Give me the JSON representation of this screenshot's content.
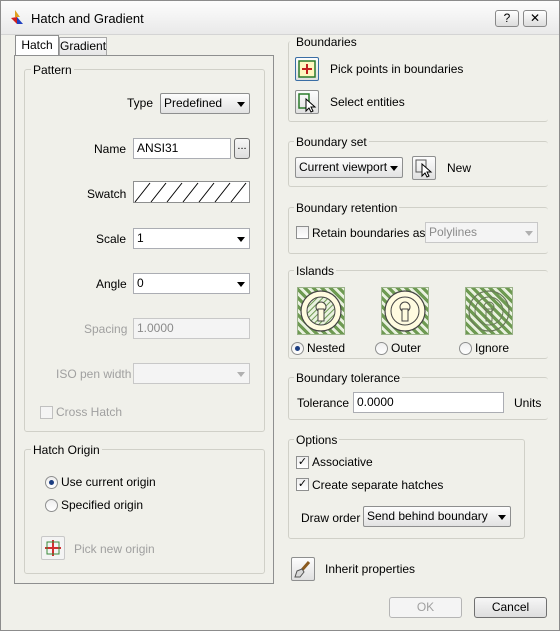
{
  "window": {
    "title": "Hatch and Gradient",
    "help_label": "?",
    "close_label": "✕"
  },
  "tabs": [
    {
      "label": "Hatch"
    },
    {
      "label": "Gradient"
    }
  ],
  "pattern": {
    "title": "Pattern",
    "type_label": "Type",
    "type_value": "Predefined",
    "name_label": "Name",
    "name_value": "ANSI31",
    "browse_label": "...",
    "swatch_label": "Swatch",
    "scale_label": "Scale",
    "scale_value": "1",
    "angle_label": "Angle",
    "angle_value": "0",
    "spacing_label": "Spacing",
    "spacing_value": "1.0000",
    "iso_label": "ISO pen width",
    "iso_value": "",
    "cross_hatch_label": "Cross Hatch",
    "cross_hatch_checked": false
  },
  "hatch_origin": {
    "title": "Hatch Origin",
    "use_current_label": "Use current origin",
    "specified_label": "Specified origin",
    "selected": "use_current",
    "pick_new_label": "Pick new origin"
  },
  "boundaries": {
    "title": "Boundaries",
    "pick_points_label": "Pick points in boundaries",
    "select_entities_label": "Select entities"
  },
  "boundary_set": {
    "title": "Boundary set",
    "value": "Current viewport",
    "new_label": "New"
  },
  "boundary_retention": {
    "title": "Boundary retention",
    "retain_label": "Retain boundaries as",
    "retain_checked": false,
    "type_value": "Polylines"
  },
  "islands": {
    "title": "Islands",
    "options": [
      {
        "label": "Nested"
      },
      {
        "label": "Outer"
      },
      {
        "label": "Ignore"
      }
    ],
    "selected": "Nested"
  },
  "boundary_tolerance": {
    "title": "Boundary tolerance",
    "tolerance_label": "Tolerance",
    "tolerance_value": "0.0000",
    "units_label": "Units"
  },
  "options": {
    "title": "Options",
    "associative_label": "Associative",
    "associative_checked": true,
    "separate_label": "Create separate hatches",
    "separate_checked": true,
    "draw_order_label": "Draw order",
    "draw_order_value": "Send behind boundary"
  },
  "inherit_label": "Inherit properties",
  "footer": {
    "ok_label": "OK",
    "cancel_label": "Cancel"
  }
}
